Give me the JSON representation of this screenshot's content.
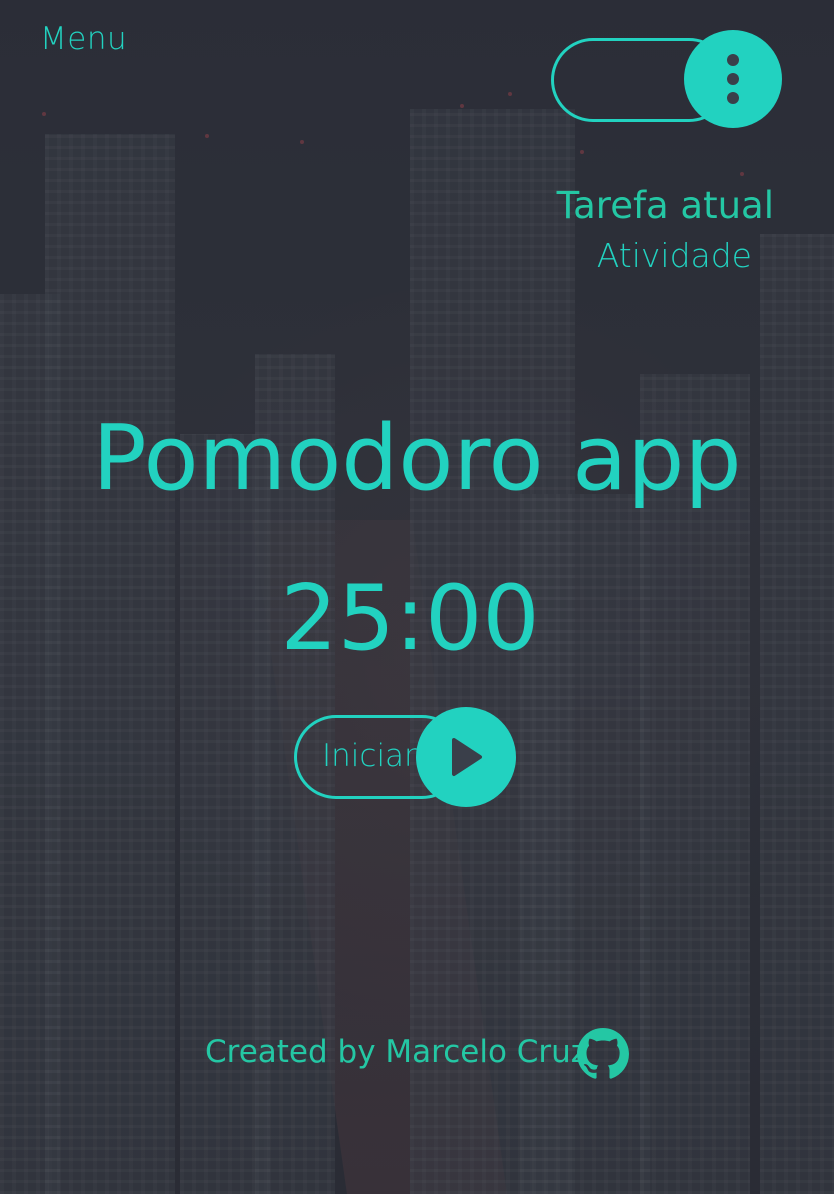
{
  "menu": {
    "label": "Menu",
    "icon": "more-vertical-icon"
  },
  "task": {
    "title": "Tarefa atual",
    "name": "Atividade"
  },
  "app": {
    "title": "Pomodoro app",
    "timer": "25:00"
  },
  "start": {
    "label": "Iniciar",
    "icon": "play-icon"
  },
  "footer": {
    "credit": "Created by Marcelo Cruz",
    "icon": "github-icon"
  },
  "colors": {
    "accent": "#22d2c0",
    "accent_alt": "#24c7a4",
    "background": "#2d2f3a"
  }
}
